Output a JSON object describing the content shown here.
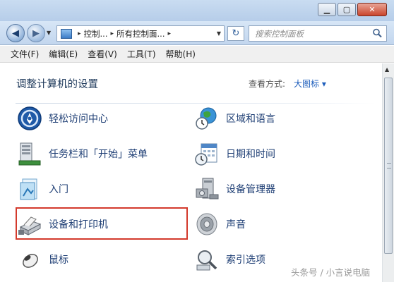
{
  "window": {
    "minimize_glyph": "▁",
    "maximize_glyph": "▢",
    "close_glyph": "✕"
  },
  "navigation": {
    "back_glyph": "◀",
    "forward_glyph": "▶",
    "dropdown_glyph": "▼",
    "breadcrumbs": [
      "控制...",
      "所有控制面..."
    ],
    "separator_glyph": "▸",
    "refresh_glyph": "↻",
    "search_placeholder": "搜索控制面板"
  },
  "menu": {
    "items": [
      "文件(F)",
      "编辑(E)",
      "查看(V)",
      "工具(T)",
      "帮助(H)"
    ]
  },
  "content": {
    "heading": "调整计算机的设置",
    "view_by_label": "查看方式:",
    "view_by_value": "大图标 ▾",
    "items": [
      {
        "label": "轻松访问中心",
        "icon": "ease-of-access-icon"
      },
      {
        "label": "区域和语言",
        "icon": "region-language-icon"
      },
      {
        "label": "任务栏和「开始」菜单",
        "icon": "taskbar-icon"
      },
      {
        "label": "日期和时间",
        "icon": "date-time-icon"
      },
      {
        "label": "入门",
        "icon": "getting-started-icon"
      },
      {
        "label": "设备管理器",
        "icon": "device-manager-icon"
      },
      {
        "label": "设备和打印机",
        "icon": "devices-printers-icon"
      },
      {
        "label": "声音",
        "icon": "sound-icon"
      },
      {
        "label": "鼠标",
        "icon": "mouse-icon"
      },
      {
        "label": "索引选项",
        "icon": "indexing-options-icon"
      }
    ],
    "highlighted_item": "设备和打印机"
  },
  "watermark": "头条号 / 小言说电脑",
  "colors": {
    "highlight_border": "#d33a2c",
    "link_text": "#1f3f75",
    "heading_text": "#1e395b"
  }
}
